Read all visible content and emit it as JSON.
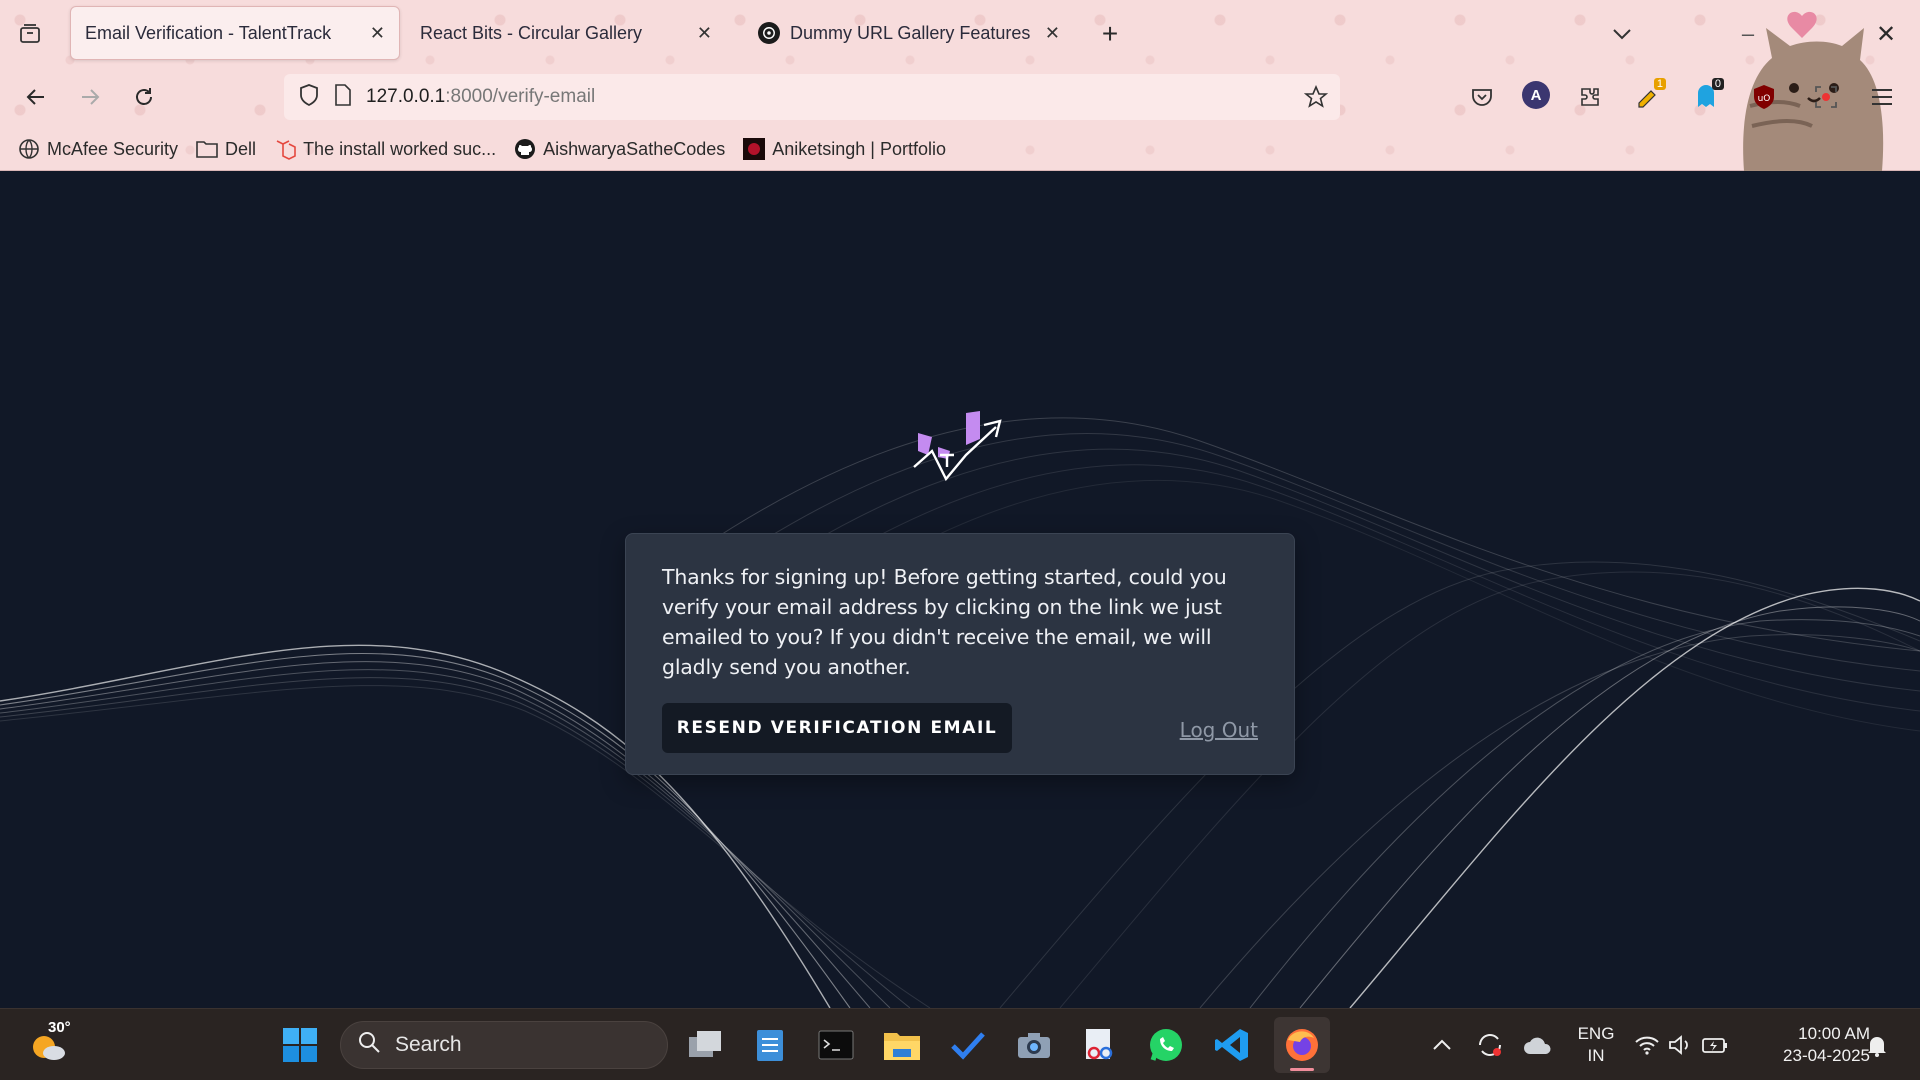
{
  "browser": {
    "tabs": [
      {
        "title": "Email Verification - TalentTrack",
        "active": true
      },
      {
        "title": "React Bits - Circular Gallery",
        "active": false
      },
      {
        "title": "Dummy URL Gallery Features",
        "active": false
      }
    ],
    "url": {
      "host": "127.0.0.1",
      "path": ":8000/verify-email"
    },
    "extension_badges": {
      "first": "1",
      "second": "0"
    },
    "profile_initial": "A",
    "bookmarks": [
      {
        "label": "McAfee Security",
        "icon": "globe-icon"
      },
      {
        "label": "Dell",
        "icon": "folder-icon"
      },
      {
        "label": "The install worked suc...",
        "icon": "django-icon"
      },
      {
        "label": "AishwaryaSatheCodes",
        "icon": "github-icon"
      },
      {
        "label": "Aniketsingh | Portfolio",
        "icon": "portfolio-icon"
      }
    ]
  },
  "page": {
    "message": "Thanks for signing up! Before getting started, could you verify your email address by clicking on the link we just emailed to you? If you didn't receive the email, we will gladly send you another.",
    "resend_button": "RESEND VERIFICATION EMAIL",
    "logout_link": "Log Out",
    "accent": "#c48bf0",
    "background": "#111827"
  },
  "taskbar": {
    "weather_temp": "30°",
    "search_placeholder": "Search",
    "lang_line1": "ENG",
    "lang_line2": "IN",
    "time": "10:00 AM",
    "date": "23-04-2025"
  }
}
